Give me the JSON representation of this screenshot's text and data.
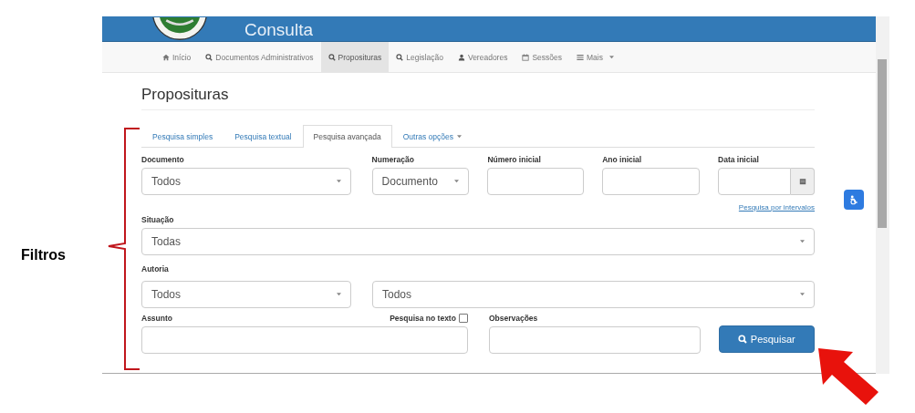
{
  "header": {
    "title": "Consulta"
  },
  "nav": [
    {
      "kind": "home",
      "label": "Início",
      "selected": false
    },
    {
      "kind": "search",
      "label": "Documentos Administrativos",
      "selected": false
    },
    {
      "kind": "search",
      "label": "Proposituras",
      "selected": true
    },
    {
      "kind": "search",
      "label": "Legislação",
      "selected": false
    },
    {
      "kind": "user",
      "label": "Vereadores",
      "selected": false
    },
    {
      "kind": "calendar",
      "label": "Sessões",
      "selected": false
    },
    {
      "kind": "menu",
      "label": "Mais",
      "selected": false,
      "dropdown": true
    }
  ],
  "page_title": "Proposituras",
  "tabs": [
    {
      "label": "Pesquisa simples",
      "selected": false
    },
    {
      "label": "Pesquisa textual",
      "selected": false
    },
    {
      "label": "Pesquisa avançada",
      "selected": true
    },
    {
      "label": "Outras opções",
      "selected": false,
      "dropdown": true
    }
  ],
  "row_1": [
    {
      "kind": "select",
      "label": "Documento",
      "value": "Todos"
    },
    {
      "kind": "select",
      "label": "Numeração",
      "value": "Documento"
    },
    {
      "kind": "input",
      "label": "Número inicial"
    },
    {
      "kind": "input",
      "label": "Ano inicial"
    },
    {
      "kind": "date",
      "label": "Data inicial"
    }
  ],
  "interval_link": "Pesquisa por intervalos",
  "situacao": {
    "label": "Situação",
    "value": "Todas"
  },
  "autoria": {
    "label": "Autoria",
    "author_type": "Todos",
    "author": "Todos"
  },
  "assunto": {
    "label": "Assunto",
    "text_search": {
      "label": "Pesquisa no texto",
      "checked": false
    }
  },
  "observacoes": {
    "label": "Observações"
  },
  "search_button": "Pesquisar",
  "annotation": {
    "label": "Filtros"
  }
}
